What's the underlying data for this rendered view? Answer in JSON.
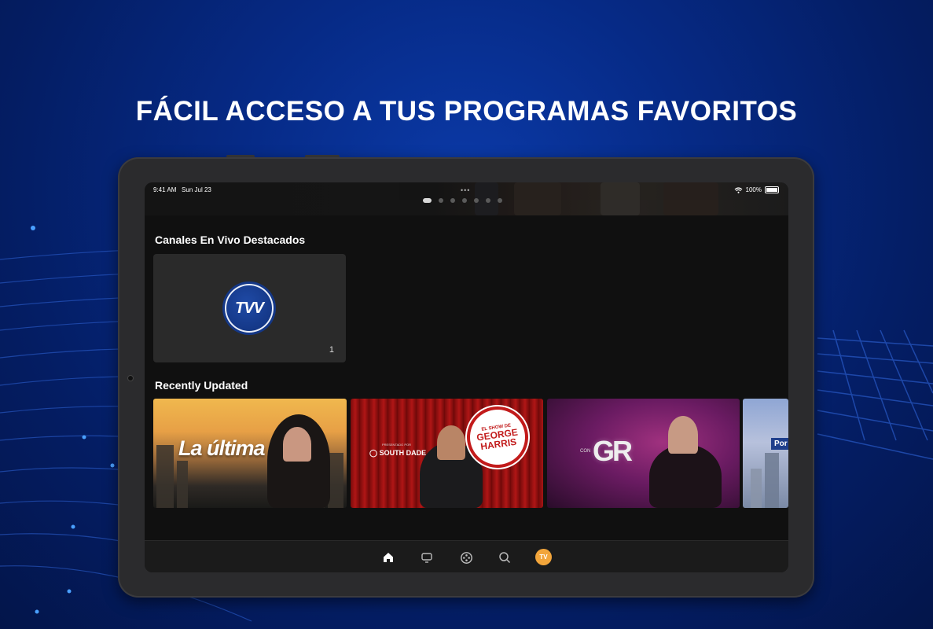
{
  "headline": "FÁCIL ACCESO A TUS PROGRAMAS FAVORITOS",
  "status_bar": {
    "time": "9:41 AM",
    "date": "Sun Jul 23",
    "battery": "100%",
    "icons": [
      "wifi-icon",
      "battery-icon"
    ]
  },
  "hero_pager": {
    "count": 7,
    "active_index": 0
  },
  "sections": {
    "live": {
      "title": "Canales En Vivo Destacados",
      "channels": [
        {
          "logo_text": "TVV",
          "number": "1"
        }
      ]
    },
    "recent": {
      "title": "Recently Updated",
      "items": [
        {
          "title": "La última"
        },
        {
          "badge_small": "EL SHOW DE",
          "badge_big_1": "GEORGE",
          "badge_big_2": "HARRIS",
          "sponsor_pre": "PRESENTADO POR",
          "sponsor": "SOUTH DADE"
        },
        {
          "prefix": "CON",
          "logo": "GR"
        },
        {
          "tag": "Por"
        }
      ]
    }
  },
  "tab_bar": {
    "items": [
      {
        "icon": "home-icon",
        "active": true
      },
      {
        "icon": "tv-icon",
        "active": false
      },
      {
        "icon": "film-reel-icon",
        "active": false
      },
      {
        "icon": "search-icon",
        "active": false
      },
      {
        "icon": "profile-avatar",
        "avatar_text": "TV",
        "active": false
      }
    ]
  },
  "colors": {
    "background": "#062a86",
    "screen_bg": "#101010",
    "card_bg": "#2a2a2a",
    "accent_avatar": "#f2a53b",
    "logo_blue": "#143786"
  }
}
